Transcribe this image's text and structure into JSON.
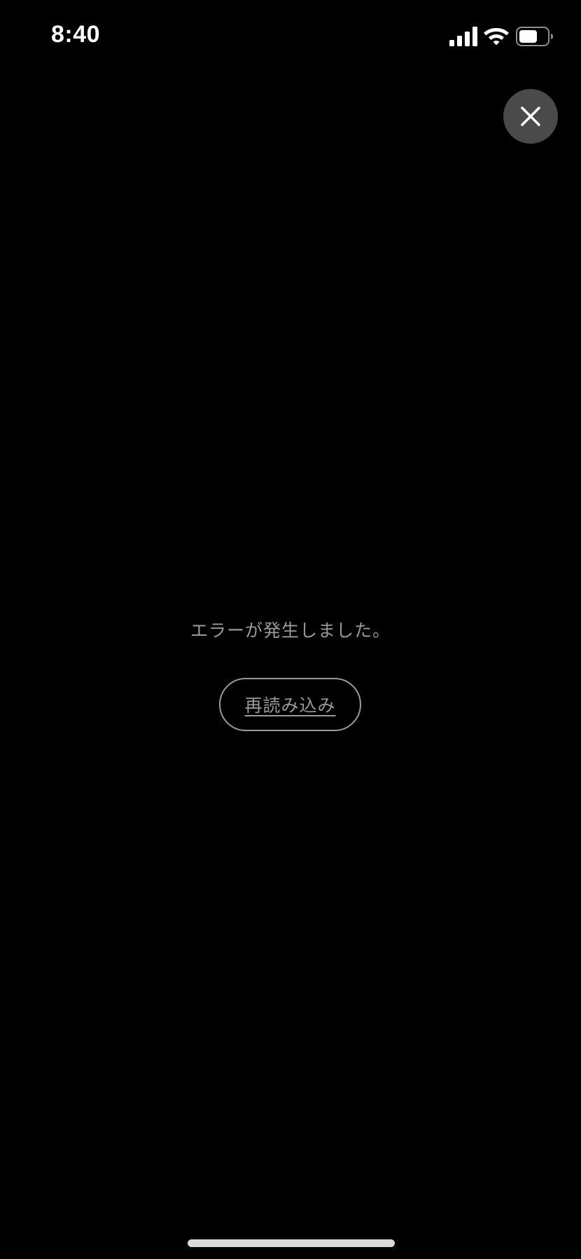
{
  "status_bar": {
    "time": "8:40",
    "signal_icon": "cellular-signal-icon",
    "wifi_icon": "wifi-icon",
    "battery_icon": "battery-icon",
    "battery_level": 0.65
  },
  "header": {
    "close_icon": "close-icon"
  },
  "main": {
    "error_message": "エラーが発生しました。",
    "reload_label": "再読み込み"
  },
  "colors": {
    "background": "#000000",
    "close_button_bg": "#4a4a4a",
    "muted_text": "#9a9a9a",
    "home_indicator": "#d9d9d9"
  }
}
